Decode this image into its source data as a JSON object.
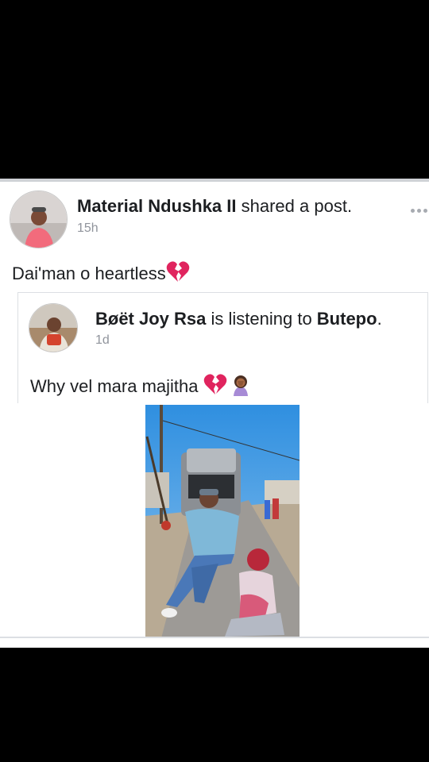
{
  "post": {
    "author": "Material Ndushka II",
    "action": " shared a post.",
    "time": "15h",
    "caption": "Dai'man o heartless"
  },
  "shared_post": {
    "author": "Bøët Joy Rsa",
    "action": " is listening to ",
    "target": "Butepo",
    "target_suffix": ".",
    "time": "1d",
    "text": "Why vel mara majitha"
  },
  "icons": {
    "more": "more-options-icon",
    "broken_heart": "broken-heart-emoji",
    "facepalm": "woman-facepalming-emoji"
  },
  "colors": {
    "text": "#1c1e21",
    "meta": "#90949c",
    "heart": "#e0245e"
  }
}
